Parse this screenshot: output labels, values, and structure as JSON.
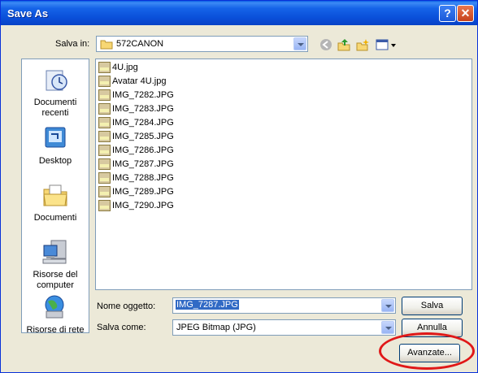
{
  "window": {
    "title": "Save As",
    "help": "?",
    "close": "✕"
  },
  "location": {
    "label": "Salva in:",
    "value": "572CANON",
    "icons": [
      "back-icon",
      "up-folder-icon",
      "new-folder-icon",
      "view-menu-icon"
    ]
  },
  "places": [
    {
      "label": "Documenti recenti",
      "icon": "recent-documents-icon"
    },
    {
      "label": "Desktop",
      "icon": "desktop-icon"
    },
    {
      "label": "Documenti",
      "icon": "documents-folder-icon"
    },
    {
      "label": "Risorse del computer",
      "icon": "my-computer-icon"
    },
    {
      "label": "Risorse di rete",
      "icon": "network-icon"
    }
  ],
  "files": [
    "4U.jpg",
    "Avatar 4U.jpg",
    "IMG_7282.JPG",
    "IMG_7283.JPG",
    "IMG_7284.JPG",
    "IMG_7285.JPG",
    "IMG_7286.JPG",
    "IMG_7287.JPG",
    "IMG_7288.JPG",
    "IMG_7289.JPG",
    "IMG_7290.JPG"
  ],
  "filename": {
    "label": "Nome oggetto:",
    "value": "IMG_7287.JPG"
  },
  "filetype": {
    "label": "Salva come:",
    "value": "JPEG Bitmap (JPG)"
  },
  "buttons": {
    "save": "Salva",
    "cancel": "Annulla",
    "advanced": "Avanzate..."
  },
  "colors": {
    "titlebar": "#0a5ee5",
    "selection": "#316ac5",
    "highlight_oval": "#e01818"
  }
}
